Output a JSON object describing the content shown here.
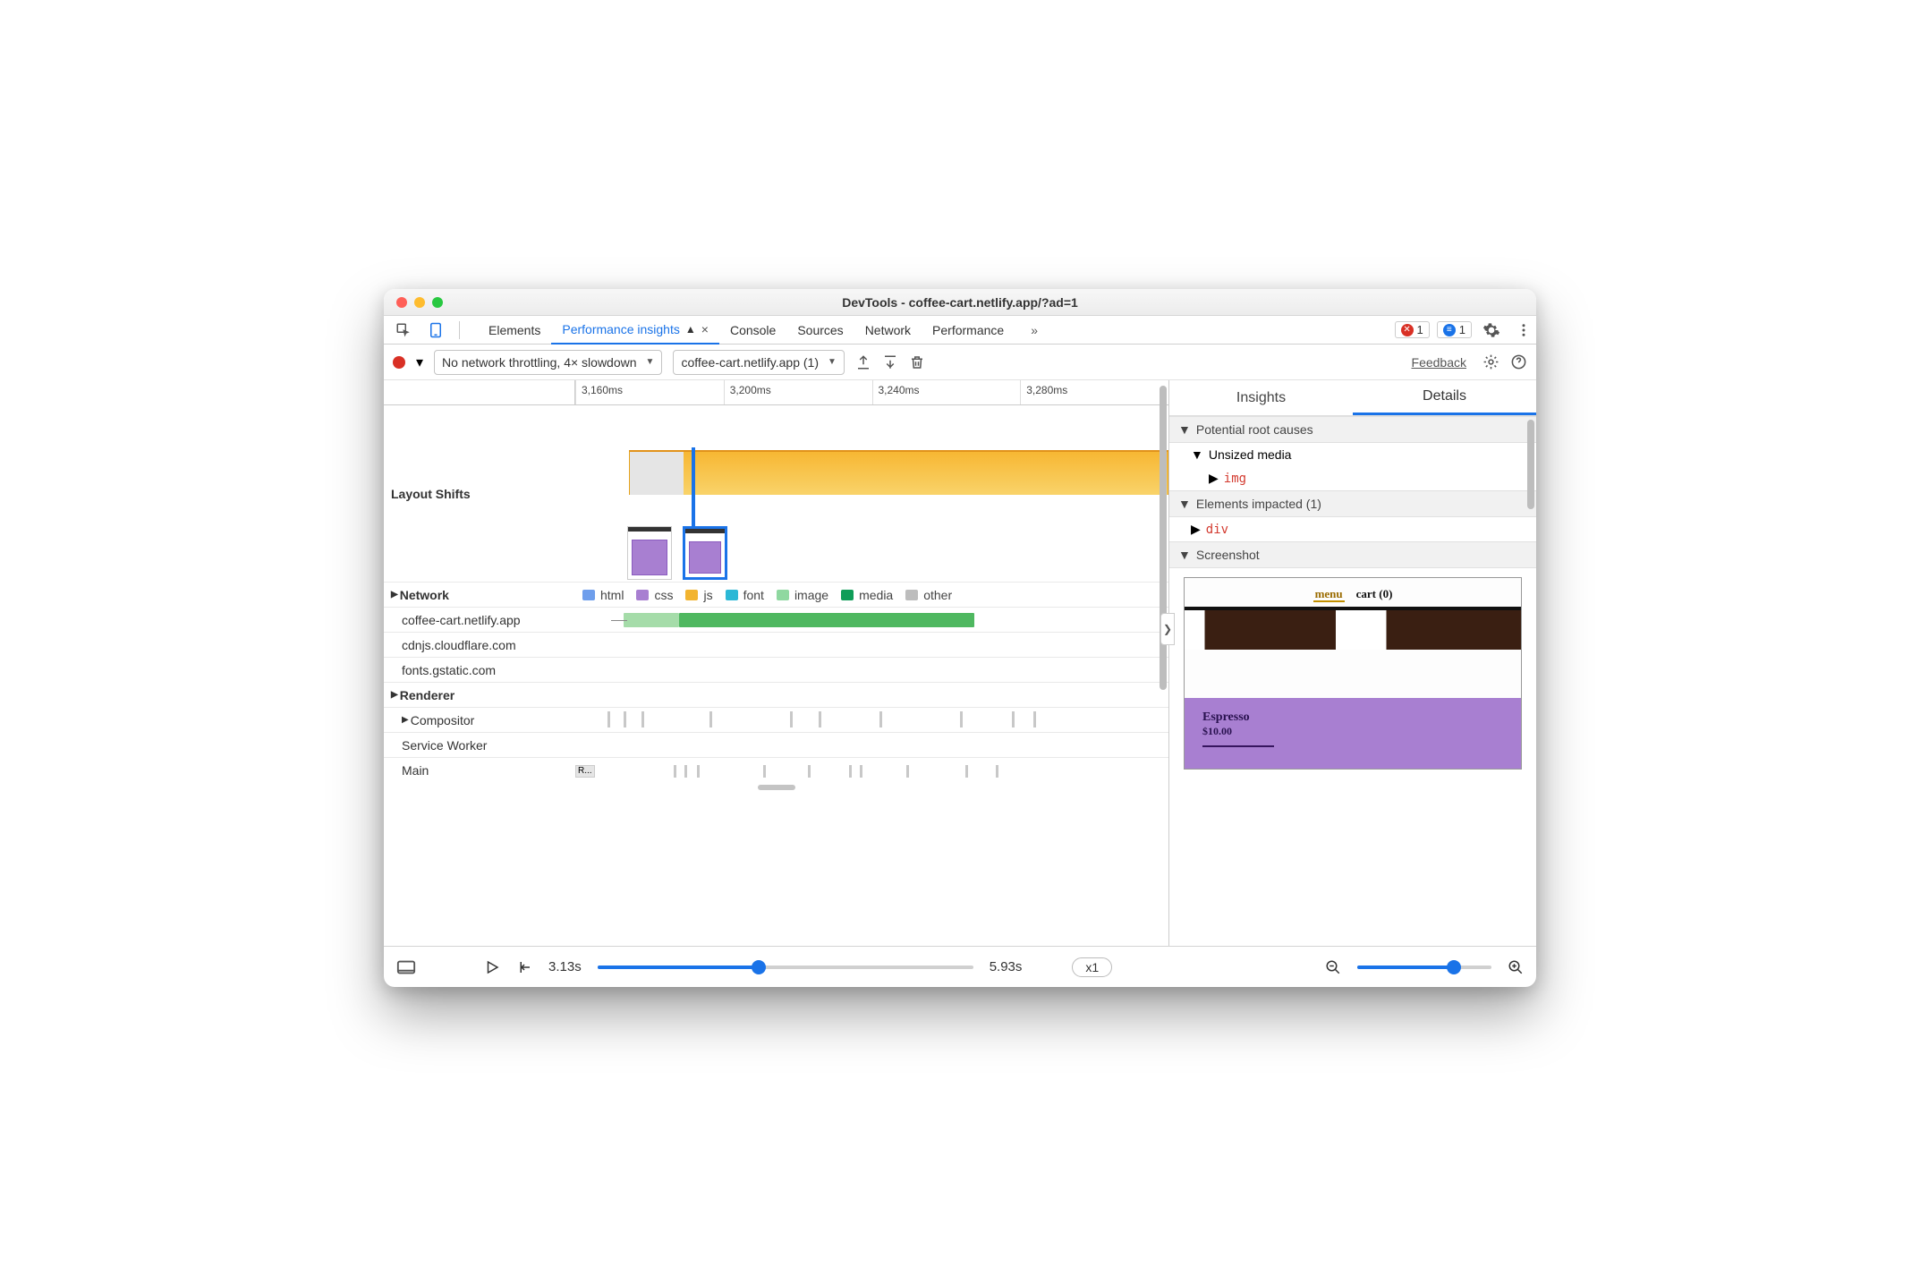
{
  "window": {
    "title": "DevTools - coffee-cart.netlify.app/?ad=1"
  },
  "tabstrip": {
    "tabs": [
      "Elements",
      "Performance insights",
      "Console",
      "Sources",
      "Network",
      "Performance"
    ],
    "active": "Performance insights",
    "errors_count": "1",
    "info_count": "1"
  },
  "toolbar": {
    "throttling": "No network throttling, 4× slowdown",
    "target": "coffee-cart.netlify.app (1)",
    "feedback": "Feedback"
  },
  "ruler": {
    "ticks": [
      "3,160ms",
      "3,200ms",
      "3,240ms",
      "3,280ms"
    ]
  },
  "tracks": {
    "layout_shifts": "Layout Shifts",
    "network": "Network",
    "network_hosts": [
      "coffee-cart.netlify.app",
      "cdnjs.cloudflare.com",
      "fonts.gstatic.com"
    ],
    "renderer": "Renderer",
    "renderer_rows": [
      "Compositor",
      "Service Worker",
      "Main"
    ],
    "main_block_label": "R...",
    "legend": {
      "html": "html",
      "css": "css",
      "js": "js",
      "font": "font",
      "image": "image",
      "media": "media",
      "other": "other"
    }
  },
  "details": {
    "tabs": {
      "insights": "Insights",
      "details": "Details"
    },
    "sections": {
      "root_causes": "Potential root causes",
      "unsized_media": "Unsized media",
      "img": "img",
      "elements_impacted": "Elements impacted (1)",
      "div": "div",
      "screenshot": "Screenshot"
    },
    "screenshot": {
      "menu": "menu",
      "cart": "cart (0)",
      "product_name": "Espresso",
      "product_price": "$10.00"
    }
  },
  "bottombar": {
    "start": "3.13s",
    "end": "5.93s",
    "speed": "x1"
  },
  "colors": {
    "html": "#6e9eec",
    "css": "#a87fd1",
    "js": "#f2b430",
    "font": "#2cb8d6",
    "image": "#63c285",
    "media": "#0f9d58",
    "other": "#bdbdbd"
  }
}
